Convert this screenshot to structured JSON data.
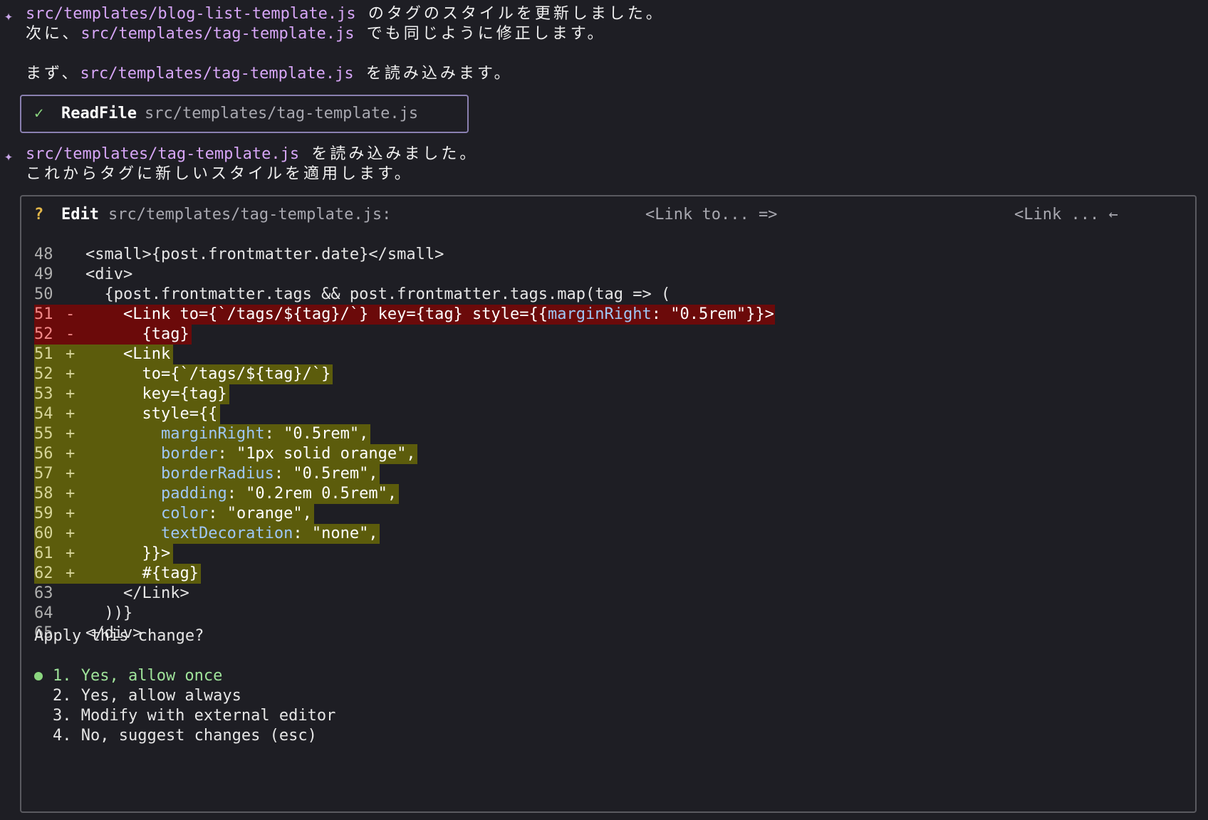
{
  "messages": [
    {
      "star": "✦",
      "lines": [
        {
          "parts": [
            {
              "t": "src/templates/blog-list-template.js",
              "c": "path"
            },
            {
              "t": " のタグのスタイルを更新しました。",
              "c": "jp"
            }
          ]
        },
        {
          "parts": [
            {
              "t": "次に、",
              "c": "jp"
            },
            {
              "t": "src/templates/tag-template.js",
              "c": "path"
            },
            {
              "t": " でも同じように修正します。",
              "c": "jp"
            }
          ]
        }
      ]
    },
    {
      "star": "",
      "lines": [
        {
          "parts": [
            {
              "t": "まず、",
              "c": "jp"
            },
            {
              "t": "src/templates/tag-template.js",
              "c": "path"
            },
            {
              "t": " を読み込みます。",
              "c": "jp"
            }
          ]
        }
      ]
    },
    {
      "star": "✦",
      "lines": [
        {
          "parts": [
            {
              "t": "src/templates/tag-template.js",
              "c": "path"
            },
            {
              "t": " を読み込みました。",
              "c": "jp"
            }
          ]
        },
        {
          "parts": [
            {
              "t": "これからタグに新しいスタイルを適用します。",
              "c": "jp"
            }
          ]
        }
      ]
    }
  ],
  "read_tool": {
    "status_icon": "✓",
    "name": "ReadFile",
    "arg": "src/templates/tag-template.js"
  },
  "edit_tool": {
    "status_icon": "?",
    "name": "Edit",
    "arg": "src/templates/tag-template.js:",
    "old_snippet": "<Link to... =>",
    "new_snippet": "<Link ... ←"
  },
  "diff": [
    {
      "n": "48",
      "s": "",
      "k": "ctx",
      "code": [
        {
          "t": "<small>{post.frontmatter.date}</small>"
        }
      ]
    },
    {
      "n": "49",
      "s": "",
      "k": "ctx",
      "code": [
        {
          "t": "<div>"
        }
      ]
    },
    {
      "n": "50",
      "s": "",
      "k": "ctx",
      "code": [
        {
          "t": "  {post.frontmatter.tags && post.frontmatter.tags.map(tag => ("
        }
      ]
    },
    {
      "n": "51",
      "s": "-",
      "k": "del",
      "code": [
        {
          "t": "    <Link to={`/tags/${tag}/`} key={tag} style={{"
        },
        {
          "t": "marginRight",
          "c": "prop"
        },
        {
          "t": ": \"0.5rem\"}}>"
        }
      ]
    },
    {
      "n": "52",
      "s": "-",
      "k": "del",
      "code": [
        {
          "t": "      {tag}"
        }
      ]
    },
    {
      "n": "51",
      "s": "+",
      "k": "add",
      "code": [
        {
          "t": "    <Link"
        }
      ]
    },
    {
      "n": "52",
      "s": "+",
      "k": "add",
      "code": [
        {
          "t": "      to={`/tags/${tag}/`}"
        }
      ]
    },
    {
      "n": "53",
      "s": "+",
      "k": "add",
      "code": [
        {
          "t": "      key={tag}"
        }
      ]
    },
    {
      "n": "54",
      "s": "+",
      "k": "add",
      "code": [
        {
          "t": "      style={{"
        }
      ]
    },
    {
      "n": "55",
      "s": "+",
      "k": "add",
      "code": [
        {
          "t": "        "
        },
        {
          "t": "marginRight",
          "c": "prop"
        },
        {
          "t": ": \"0.5rem\","
        }
      ]
    },
    {
      "n": "56",
      "s": "+",
      "k": "add",
      "code": [
        {
          "t": "        "
        },
        {
          "t": "border",
          "c": "prop"
        },
        {
          "t": ": \"1px solid orange\","
        }
      ]
    },
    {
      "n": "57",
      "s": "+",
      "k": "add",
      "code": [
        {
          "t": "        "
        },
        {
          "t": "borderRadius",
          "c": "prop"
        },
        {
          "t": ": \"0.5rem\","
        }
      ]
    },
    {
      "n": "58",
      "s": "+",
      "k": "add",
      "code": [
        {
          "t": "        "
        },
        {
          "t": "padding",
          "c": "prop"
        },
        {
          "t": ": \"0.2rem 0.5rem\","
        }
      ]
    },
    {
      "n": "59",
      "s": "+",
      "k": "add",
      "code": [
        {
          "t": "        "
        },
        {
          "t": "color",
          "c": "prop"
        },
        {
          "t": ": \"orange\","
        }
      ]
    },
    {
      "n": "60",
      "s": "+",
      "k": "add",
      "code": [
        {
          "t": "        "
        },
        {
          "t": "textDecoration",
          "c": "prop"
        },
        {
          "t": ": \"none\","
        }
      ]
    },
    {
      "n": "61",
      "s": "+",
      "k": "add",
      "code": [
        {
          "t": "      }}>"
        }
      ]
    },
    {
      "n": "62",
      "s": "+",
      "k": "add",
      "code": [
        {
          "t": "      #{tag}"
        }
      ]
    },
    {
      "n": "63",
      "s": "",
      "k": "ctx",
      "code": [
        {
          "t": "    </Link>"
        }
      ]
    },
    {
      "n": "64",
      "s": "",
      "k": "ctx",
      "code": [
        {
          "t": "  ))}"
        }
      ]
    },
    {
      "n": "65",
      "s": "",
      "k": "ctx",
      "code": [
        {
          "t": "</div>"
        }
      ]
    }
  ],
  "prompt": "Apply this change?",
  "options": [
    {
      "label": "1. Yes, allow once",
      "selected": true
    },
    {
      "label": "2. Yes, allow always",
      "selected": false
    },
    {
      "label": "3. Modify with external editor",
      "selected": false
    },
    {
      "label": "4. No, suggest changes (esc)",
      "selected": false
    }
  ],
  "colors": {
    "background": "#1e1e24",
    "path": "#d7a6f7",
    "deleted_bg": "#6b0a0a",
    "added_bg": "#5c5c0c",
    "selected_option": "#9fe39a"
  }
}
